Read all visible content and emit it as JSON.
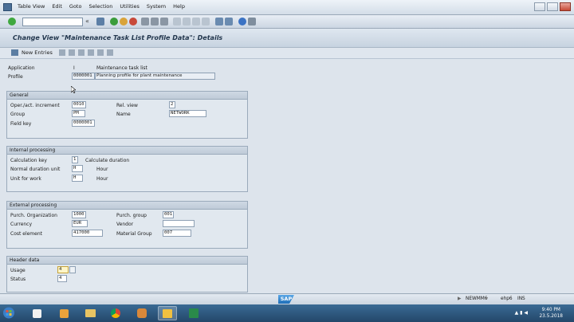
{
  "menu": [
    "Table View",
    "Edit",
    "Goto",
    "Selection",
    "Utilities",
    "System",
    "Help"
  ],
  "title": "Change View \"Maintenance Task List Profile Data\": Details",
  "app_toolbar": {
    "new_entries": "New Entries"
  },
  "header": {
    "application_label": "Application",
    "application_value": "I",
    "application_desc": "Maintenance task list",
    "profile_label": "Profile",
    "profile_value": "0000001",
    "profile_desc": "Planning profile for plant maintenance"
  },
  "general": {
    "title": "General",
    "op_increment_label": "Oper./act. increment",
    "op_increment_value": "0010",
    "rel_view_label": "Rel. view",
    "rel_view_value": "2",
    "group_label": "Group",
    "group_value": "PM",
    "name_label": "Name",
    "name_value": "NETWORK",
    "field_key_label": "Field key",
    "field_key_value": "0000001"
  },
  "internal": {
    "title": "Internal processing",
    "calc_key_label": "Calculation key",
    "calc_key_value": "1",
    "calc_key_desc": "Calculate duration",
    "normal_dur_label": "Normal duration unit",
    "normal_dur_value": "H",
    "normal_dur_desc": "Hour",
    "unit_work_label": "Unit for work",
    "unit_work_value": "H",
    "unit_work_desc": "Hour"
  },
  "external": {
    "title": "External processing",
    "purch_org_label": "Purch. Organization",
    "purch_org_value": "1000",
    "purch_group_label": "Purch. group",
    "purch_group_value": "001",
    "currency_label": "Currency",
    "currency_value": "EUR",
    "vendor_label": "Vendor",
    "vendor_value": "",
    "cost_element_label": "Cost element",
    "cost_element_value": "417000",
    "material_group_label": "Material Group",
    "material_group_value": "007"
  },
  "header_data": {
    "title": "Header data",
    "usage_label": "Usage",
    "usage_value": "4",
    "status_label": "Status",
    "status_value": "4"
  },
  "statusbar": {
    "sap": "SAP",
    "transaction": "NEWMM6",
    "server": "ehp6",
    "mode": "INS"
  },
  "taskbar": {
    "time": "9:40 PM",
    "date": "23.5.2018"
  },
  "colors": {
    "accent": "#22364d",
    "panel": "#dde4ec",
    "taskbar": "#24476a"
  }
}
